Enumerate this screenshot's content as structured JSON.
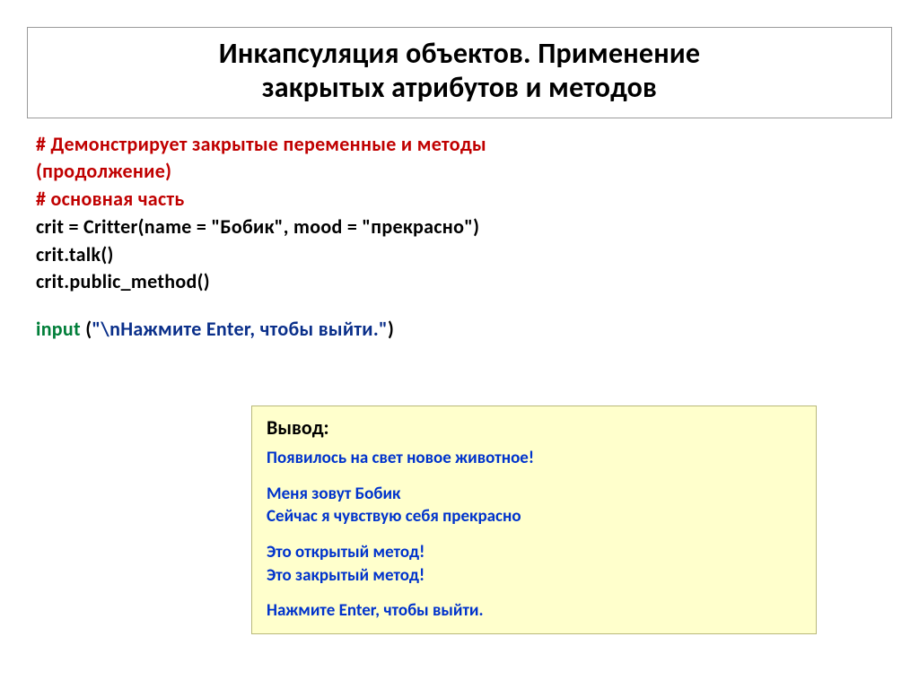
{
  "title": {
    "line1": "Инкапсуляция объектов. Применение",
    "line2": "закрытых атрибутов и методов"
  },
  "code": {
    "comment1": "# Демонстрирует закрытые переменные и методы",
    "comment2": "(продолжение)",
    "comment3": "# основная часть",
    "line_crit_pre": "crit = Critter(name = ",
    "str_bobik": "\"Бобик\"",
    "line_crit_mid": ", mood = ",
    "str_mood": "\"прекрасно\"",
    "line_crit_end": ")",
    "line_talk": "crit.talk()",
    "line_public": "crit.public_method()",
    "input_kw": "input ",
    "input_open": "(",
    "input_str": "\"\\nНажмите Enter, чтобы выйти.\"",
    "input_close": ")"
  },
  "output": {
    "title": "Вывод:",
    "l1": "Появилось на свет новое животное!",
    "l2": "Меня зовут Бобик",
    "l3": "Сейчас я чувствую себя прекрасно",
    "l4": "Это открытый метод!",
    "l5": "Это закрытый метод!",
    "l6": "Нажмите Enter, чтобы выйти."
  }
}
